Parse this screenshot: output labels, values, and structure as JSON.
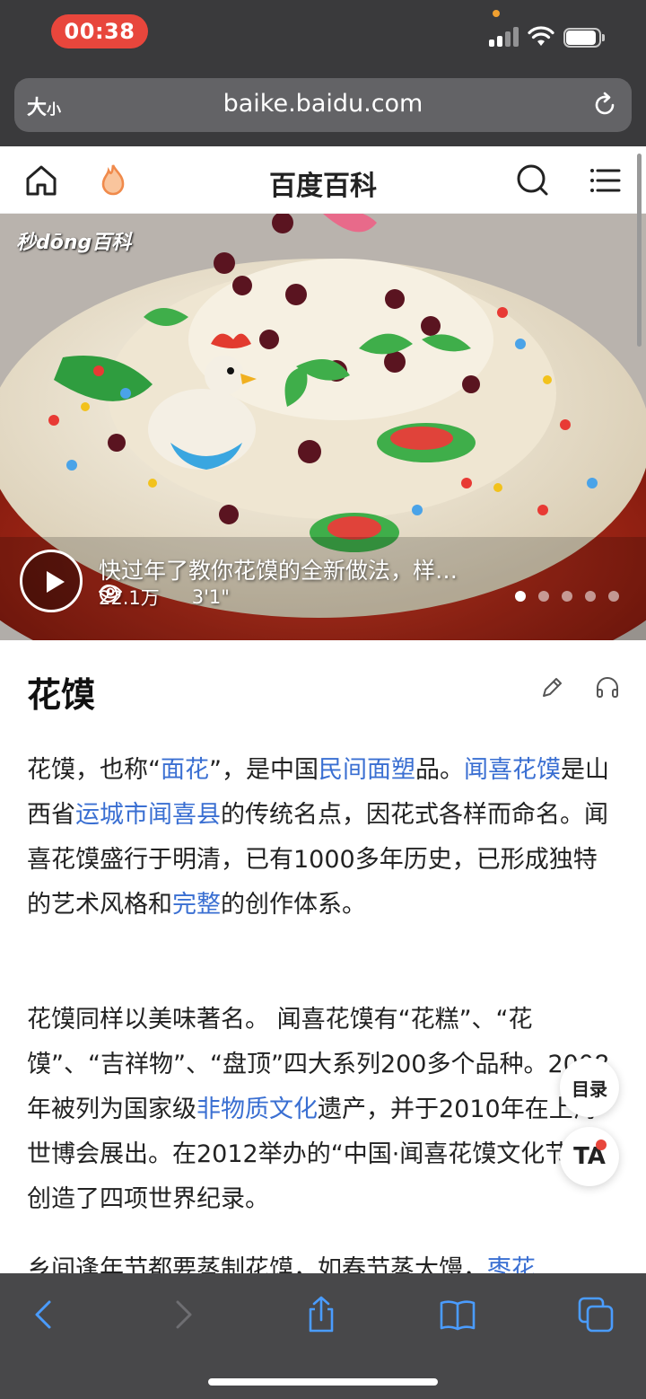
{
  "status": {
    "time": "00:38"
  },
  "browser": {
    "text_size_label": "大",
    "text_size_small": "小",
    "url": "baike.baidu.com"
  },
  "site": {
    "title": "百度百科"
  },
  "hero": {
    "watermark": "秒dōng百科",
    "video_title": "快过年了教你花馍的全新做法，样…",
    "views": "22.1万",
    "duration": "3'1\"",
    "slides": 5,
    "active_slide": 1
  },
  "article": {
    "title": "花馍",
    "paragraphs": [
      [
        {
          "t": "花馍，也称“"
        },
        {
          "t": "面花",
          "link": true
        },
        {
          "t": "”，是中国"
        },
        {
          "t": "民间面塑",
          "link": true
        },
        {
          "t": "品。"
        },
        {
          "t": "闻喜花馍",
          "link": true
        },
        {
          "t": "是山西省"
        },
        {
          "t": "运城市",
          "link": true
        },
        {
          "t": "闻喜县",
          "link": true
        },
        {
          "t": "的传统名点，因花式各样而命名。闻喜花馍盛行于明清，已有1000多年历史，已形成独特的艺术风格和"
        },
        {
          "t": "完整",
          "link": true
        },
        {
          "t": "的创作体系。"
        }
      ],
      [
        {
          "t": "花馍同样以美味著名。 闻喜花馍有“花糕”、“花馍”、“吉祥物”、“盘顶”四大系列200多个品种。2008年被列为国家级"
        },
        {
          "t": "非物质文化",
          "link": true
        },
        {
          "t": "遗产，并于2010年在上海世博会展出。在2012举办的“中国·闻喜花馍文化节”上创造了四项世界纪录。"
        }
      ],
      [
        {
          "t": "乡间逢年节都要蒸制花馍，如春节蒸大馒，"
        },
        {
          "t": "枣花",
          "link": true
        }
      ]
    ]
  },
  "floating": {
    "toc_label": "目录",
    "ta_label": "TA"
  }
}
